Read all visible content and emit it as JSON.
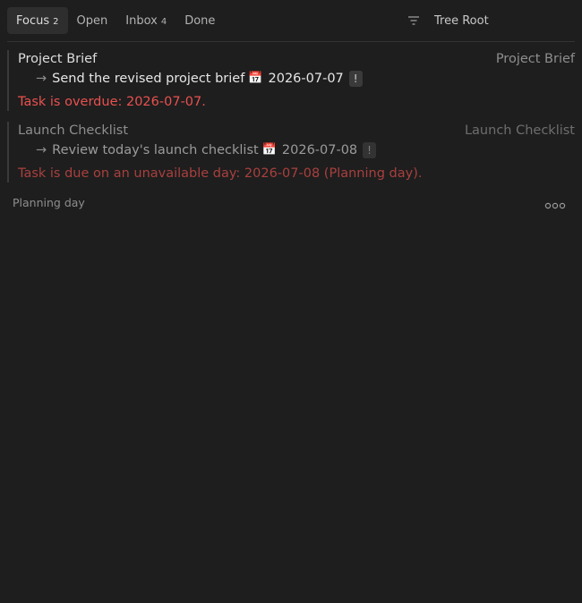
{
  "tabs": [
    {
      "label": "Focus",
      "count": "2"
    },
    {
      "label": "Open",
      "count": ""
    },
    {
      "label": "Inbox",
      "count": "4"
    },
    {
      "label": "Done",
      "count": ""
    }
  ],
  "scope": {
    "label": "Tree Root"
  },
  "tasks": [
    {
      "title": "Project Brief",
      "source": "Project Brief",
      "arrow": "→",
      "text": "Send the revised project brief",
      "calendar_icon": "📅",
      "due": "2026-07-07",
      "priority": "!",
      "message": "Task is overdue: 2026-07-07."
    },
    {
      "title": "Launch Checklist",
      "source": "Launch Checklist",
      "arrow": "→",
      "text": "Review today's launch checklist",
      "calendar_icon": "📅",
      "due": "2026-07-08",
      "priority": "!",
      "message": "Task is due on an unavailable day: 2026-07-08 (Planning day)."
    }
  ],
  "footer": {
    "label": "Planning day"
  },
  "colors": {
    "background": "#1e1e1e",
    "overdue": "#e9514f",
    "unavailable": "#a9403e"
  }
}
